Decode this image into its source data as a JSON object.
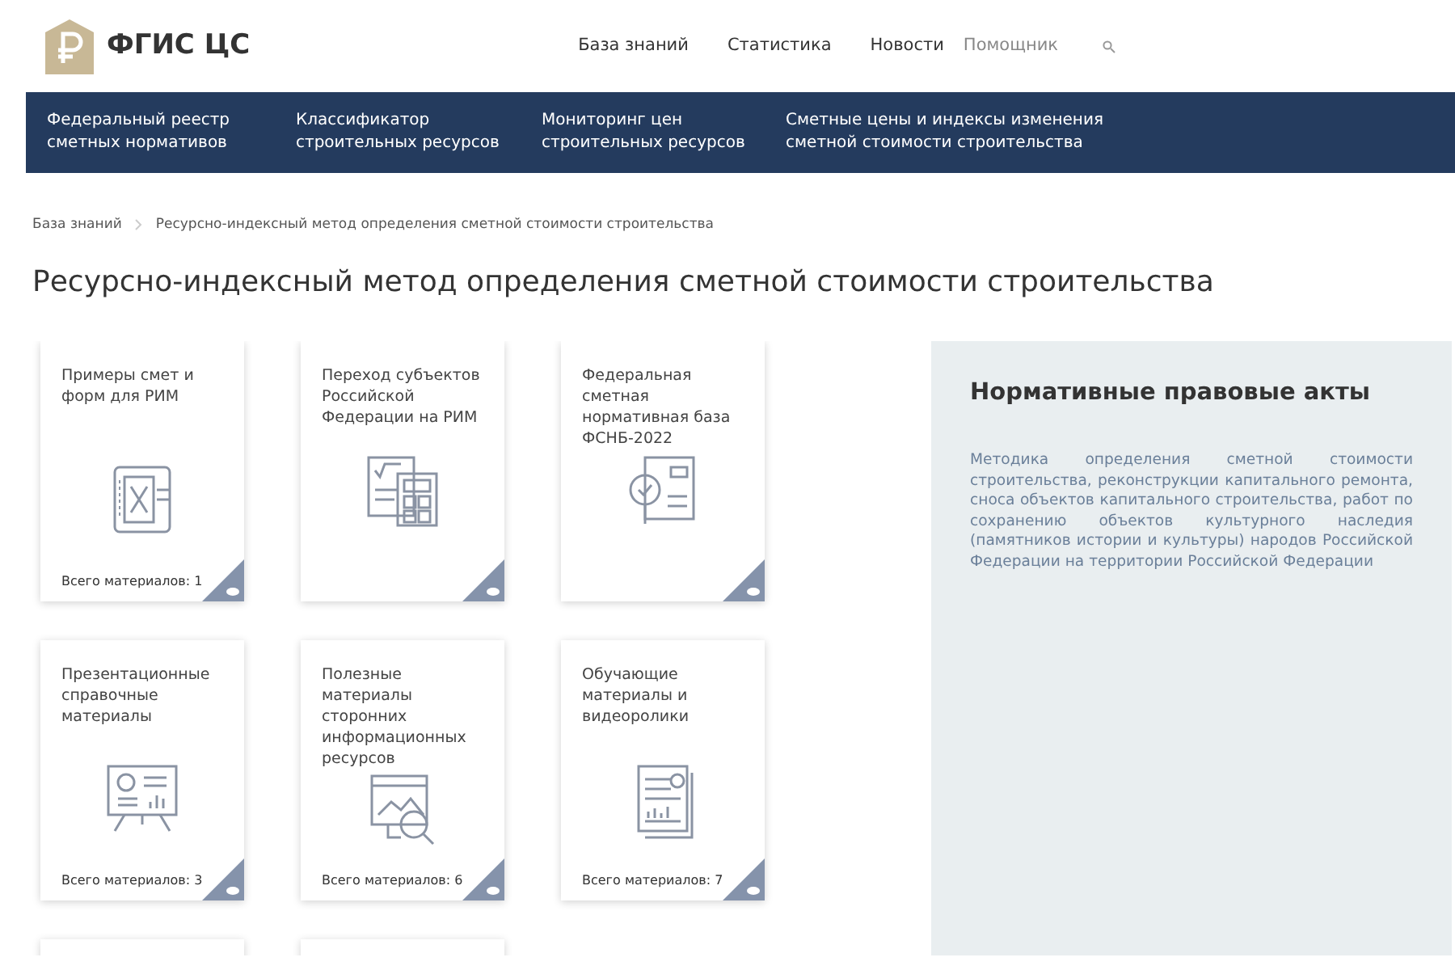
{
  "header": {
    "logo_text": "ФГИС ЦС",
    "nav": [
      "База знаний",
      "Статистика",
      "Новости"
    ],
    "search": {
      "placeholder": "Помощник"
    }
  },
  "menu": [
    "Федеральный реестр\nсметных нормативов",
    "Классификатор\nстроительных ресурсов",
    "Мониторинг цен\nстроительных ресурсов",
    "Сметные цены и индексы изменения\nсметной стоимости строительства"
  ],
  "breadcrumb": [
    "База знаний",
    "Ресурсно-индексный метод определения сметной стоимости строительства"
  ],
  "title": "Ресурсно-индексный метод определения сметной стоимости строительства",
  "cards": [
    {
      "kind": "full",
      "title": "Примеры смет и форм для РИМ",
      "count": "Всего материалов: 1"
    },
    {
      "kind": "full",
      "title": "Переход субъектов Российской Федерации на РИМ"
    },
    {
      "kind": "full",
      "title": "Федеральная сметная нормативная база ФСНБ-2022"
    },
    {
      "kind": "full",
      "title": "Презентационные справочные материалы",
      "count": "Всего материалов: 3"
    },
    {
      "kind": "full",
      "title": "Полезные материалы сторонних информационных ресурсов",
      "count": "Всего материалов: 6"
    },
    {
      "kind": "full",
      "title": "Обучающие материалы и видеоролики",
      "count": "Всего материалов: 7"
    },
    {
      "kind": "partial"
    },
    {
      "kind": "partial"
    }
  ],
  "panel": {
    "title": "Нормативные правовые акты",
    "link": "Методика определения сметной стоимости строительства, реконструкции капитального ремонта, сноса объектов капитального строительства, работ по сохранению объектов культурного наследия (памятников истории и культуры) народов Российской Федерации на территории Российской Федерации"
  }
}
